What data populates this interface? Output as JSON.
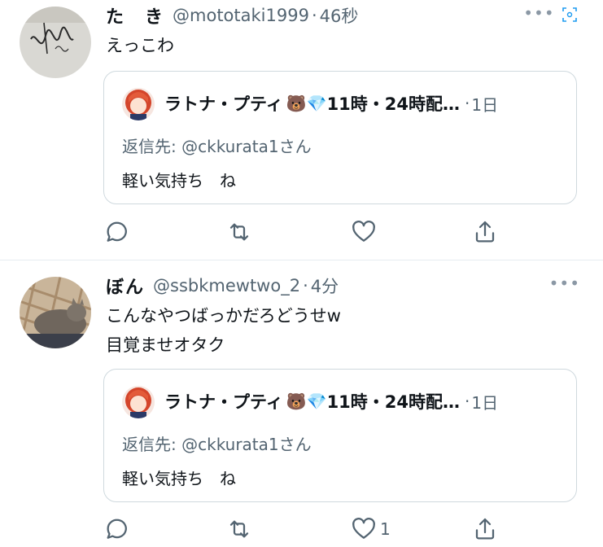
{
  "tweets": [
    {
      "name": "た　き",
      "handle": "@mototaki1999",
      "time": "46秒",
      "text_lines": [
        "えっこわ"
      ],
      "avatar_icon": "autograph-photo",
      "quote": {
        "name": "ラトナ・プティ",
        "badge_emojis": "🐻💎",
        "name_suffix": "11時・24時配…",
        "time": "1日",
        "reply_prefix": "返信先: ",
        "reply_handle": "@ckkurata1さん",
        "text": "軽い気持ち　ね"
      },
      "like_count": ""
    },
    {
      "name": "ぼん",
      "handle": "@ssbkmewtwo_2",
      "time": "4分",
      "text_lines": [
        "こんなやつばっかだろどうせw",
        "目覚ませオタク"
      ],
      "avatar_icon": "cat-photo",
      "quote": {
        "name": "ラトナ・プティ",
        "badge_emojis": "🐻💎",
        "name_suffix": "11時・24時配…",
        "time": "1日",
        "reply_prefix": "返信先: ",
        "reply_handle": "@ckkurata1さん",
        "text": "軽い気持ち　ね"
      },
      "like_count": "1"
    }
  ],
  "separator": "·",
  "more_label": "•••",
  "colors": {
    "secondary_text": "#536471",
    "border": "#cfd9de",
    "divider": "#e6ecf0"
  }
}
